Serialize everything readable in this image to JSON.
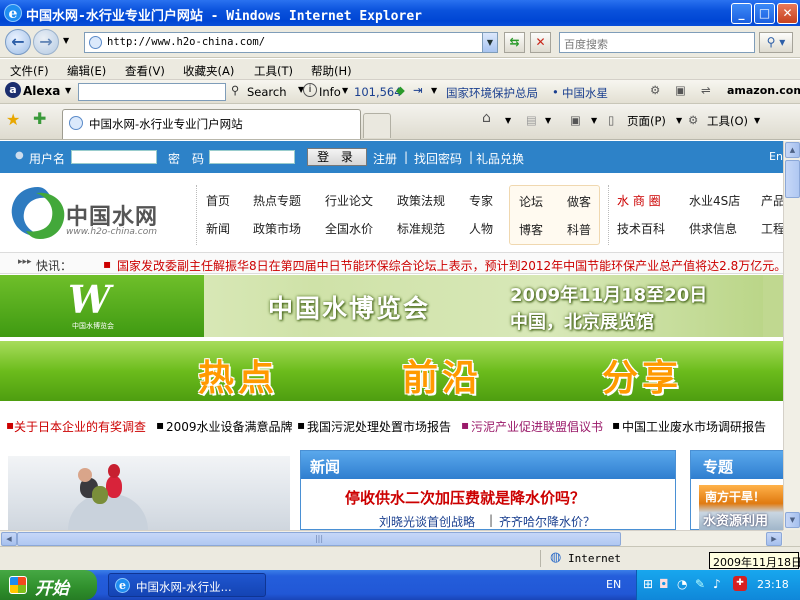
{
  "window": {
    "title": "中国水网-水行业专业门户网站 - Windows Internet Explorer",
    "ie_glyph": "e",
    "min": "_",
    "max": "□",
    "close": "✕"
  },
  "address": {
    "url": "http://www.h2o-china.com/",
    "search_placeholder": "百度搜索"
  },
  "menu": [
    "文件(F)",
    "编辑(E)",
    "查看(V)",
    "收藏夹(A)",
    "工具(T)",
    "帮助(H)"
  ],
  "alexa": {
    "brand": "Alexa",
    "search": "Search",
    "info": "Info",
    "rank": "101,564",
    "link1": "国家环境保护总局",
    "link2": "中国水星",
    "amazon": "amazon.com."
  },
  "tab": {
    "title": "中国水网-水行业专业门户网站",
    "page_menu": "页面(P)",
    "tools_menu": "工具(O)"
  },
  "site": {
    "login": {
      "user_label": "用户名",
      "pwd_label": "密　码",
      "login_button": "登 录",
      "register": "注册",
      "forgot": "找回密码",
      "gift": "礼品兑换",
      "lang": "En"
    },
    "logo": {
      "name": "中国水网",
      "url": "www.h2o-china.com"
    },
    "nav1": [
      [
        "首页",
        "热点专题",
        "行业论文",
        "政策法规",
        "专家"
      ],
      [
        "新闻",
        "政策市场",
        "全国水价",
        "标准规范",
        "人物"
      ]
    ],
    "nav2": [
      [
        "论坛",
        "做客"
      ],
      [
        "博客",
        "科普"
      ]
    ],
    "nav3": [
      [
        "水 商 圈",
        "水业4S店",
        "产品"
      ],
      [
        "技术百科",
        "供求信息",
        "工程"
      ]
    ],
    "ticker": {
      "label": "快讯：",
      "text": "国家发改委副主任解振华8日在第四届中日节能环保综合论坛上表示，预计到2012年中国节能环保产业总产值将达2.8万亿元。"
    },
    "expo": {
      "title": "中国水博览会",
      "date": "2009年11月18至20日",
      "place": "中国，北京展览馆",
      "logo_text": "中国水博览会"
    },
    "hot": [
      "热点",
      "前沿",
      "分享"
    ],
    "links": [
      "关于日本企业的有奖调查",
      "2009水业设备满意品牌",
      "我国污泥处理处置市场报告",
      "污泥产业促进联盟倡议书",
      "中国工业废水市场调研报告"
    ],
    "news": {
      "header": "新闻",
      "headline": "停收供水二次加压费就是降水价吗？",
      "sub1": "刘晓光谈首创战略",
      "sub2": "齐齐哈尔降水价？"
    },
    "topic": {
      "header": "专题",
      "banner1": "南方干旱！",
      "banner2": "水资源利用"
    }
  },
  "status": {
    "zone": "Internet",
    "tooltip": "2009年11月18日"
  },
  "taskbar": {
    "start": "开始",
    "task": "中国水网-水行业...",
    "lang": "EN",
    "time": "23:18"
  },
  "colors": {
    "accent": "#2d82c8",
    "red_link": "#cc0000",
    "green_banner": "#6cbc1c",
    "hot_text": "#ff9a00"
  }
}
